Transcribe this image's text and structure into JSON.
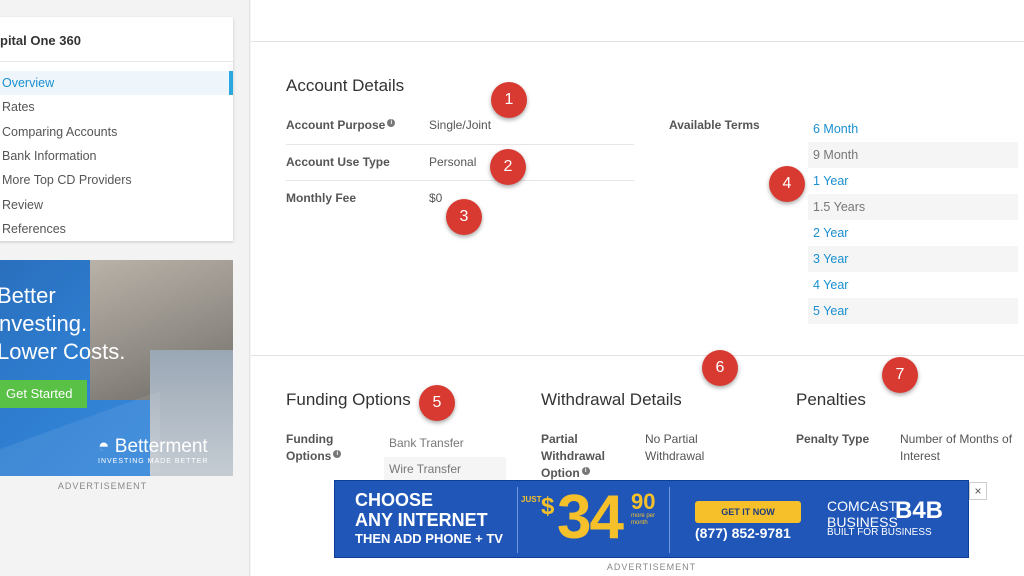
{
  "sidebar": {
    "title": "pital One 360",
    "items": [
      "Overview",
      "Rates",
      "Comparing Accounts",
      "Bank Information",
      "More Top CD Providers",
      "Review",
      "References"
    ],
    "active": "Overview"
  },
  "side_ad": {
    "headline_1": "Better",
    "headline_2": "nvesting.",
    "headline_3": "Lower Costs.",
    "button": "Get Started",
    "brand": "Betterment",
    "tagline": "INVESTING MADE BETTER",
    "label": "ADVERTISEMENT"
  },
  "account_details": {
    "title": "Account Details",
    "rows": [
      {
        "label": "Account Purpose",
        "value": "Single/Joint"
      },
      {
        "label": "Account Use Type",
        "value": "Personal"
      },
      {
        "label": "Monthly Fee",
        "value": "$0"
      }
    ],
    "terms_label": "Available Terms",
    "terms": [
      "6 Month",
      "9 Month",
      "1 Year",
      "1.5 Years",
      "2 Year",
      "3 Year",
      "4 Year",
      "5 Year"
    ]
  },
  "funding": {
    "title": "Funding Options",
    "label_1": "Funding",
    "label_2": "Options",
    "options": [
      "Bank Transfer",
      "Wire Transfer"
    ]
  },
  "withdrawal": {
    "title": "Withdrawal Details",
    "label_1": "Partial",
    "label_2": "Withdrawal",
    "label_3": "Option",
    "value_1": "No Partial",
    "value_2": "Withdrawal"
  },
  "penalties": {
    "title": "Penalties",
    "label": "Penalty Type",
    "value_1": "Number of Months of",
    "value_2": "Interest"
  },
  "badges": [
    "1",
    "2",
    "3",
    "4",
    "5",
    "6",
    "7"
  ],
  "banner": {
    "line1": "CHOOSE",
    "line2": "ANY INTERNET",
    "line3": "THEN ADD PHONE + TV",
    "just": "JUST",
    "dollar": "$",
    "price": "34",
    "cents": "90",
    "per_month": "more per month",
    "cta": "GET IT NOW",
    "phone": "(877) 852-9781",
    "brand_1": "COMCAST",
    "brand_2": "BUSINESS",
    "brand_mark": "B4B",
    "brand_tag": "BUILT FOR BUSINESS",
    "close": "×",
    "label": "ADVERTISEMENT"
  },
  "colors": {
    "link": "#1b8fd0",
    "badge": "#d83a31",
    "banner_bg": "#1f56b8",
    "banner_accent": "#f5c02a",
    "ad_button": "#58c146"
  }
}
